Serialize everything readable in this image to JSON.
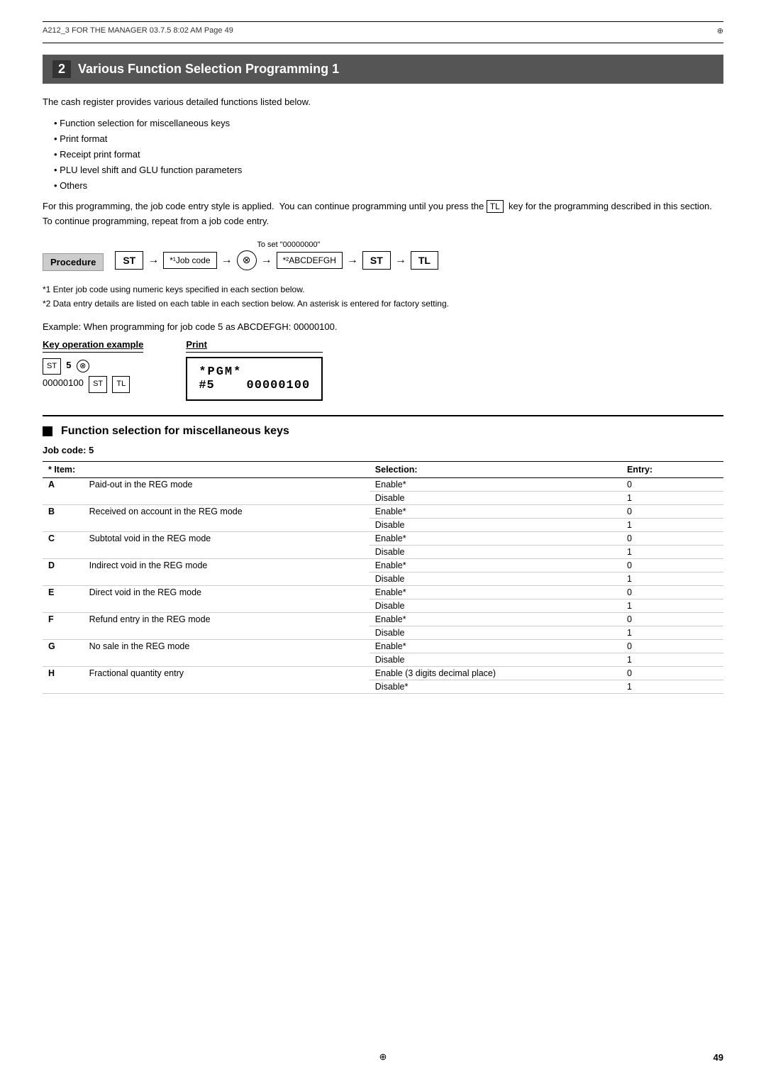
{
  "meta": {
    "header": "A212_3  FOR THE MANAGER   03.7.5  8:02 AM   Page  49"
  },
  "section": {
    "num": "2",
    "title": "Various Function Selection Programming 1"
  },
  "intro": {
    "para": "The cash register provides various detailed functions listed below.",
    "bullets": [
      "Function selection for miscellaneous keys",
      "Print format",
      "Receipt print format",
      "PLU level shift and GLU function parameters",
      "Others"
    ],
    "note": "For this programming, the job code entry style is applied.  You can continue programming until you press the  TL  key for the programming described in this section.  To continue programming, repeat from a job code entry."
  },
  "procedure": {
    "label": "Procedure",
    "toset": "To set \"00000000\"",
    "flow": [
      {
        "type": "box",
        "text": "ST"
      },
      {
        "type": "arrow",
        "text": "→"
      },
      {
        "type": "box-light",
        "text": "*¹Job code"
      },
      {
        "type": "arrow",
        "text": "→"
      },
      {
        "type": "circle",
        "text": "⊗"
      },
      {
        "type": "arrow",
        "text": "→"
      },
      {
        "type": "box-light",
        "text": "*²ABCDEFGH"
      },
      {
        "type": "arrow",
        "text": "→"
      },
      {
        "type": "box",
        "text": "ST"
      },
      {
        "type": "arrow",
        "text": "→"
      },
      {
        "type": "box",
        "text": "TL"
      }
    ]
  },
  "footnotes": [
    "*1  Enter job code using numeric keys specified in each section below.",
    "*2  Data entry details are listed on each table in each section below.  An asterisk is entered for factory setting."
  ],
  "example": {
    "text": "Example:  When programming for job code 5 as ABCDEFGH: 00000100.",
    "key_op_header": "Key operation example",
    "print_header": "Print",
    "key_ops_line1": "ST 5 ⊗",
    "key_ops_line2": "00000100 ST TL",
    "print_line1": "*PGM*",
    "print_line2": "#5    00000100"
  },
  "func_section": {
    "title": "Function selection for miscellaneous keys",
    "job_code": "Job code:  5",
    "table_headers": {
      "item": "* Item:",
      "selection": "Selection:",
      "entry": "Entry:"
    },
    "rows": [
      {
        "item": "A",
        "desc": "Paid-out in the REG mode",
        "selections": [
          {
            "sel": "Enable*",
            "entry": "0"
          },
          {
            "sel": "Disable",
            "entry": "1"
          }
        ]
      },
      {
        "item": "B",
        "desc": "Received on account in the REG mode",
        "selections": [
          {
            "sel": "Enable*",
            "entry": "0"
          },
          {
            "sel": "Disable",
            "entry": "1"
          }
        ]
      },
      {
        "item": "C",
        "desc": "Subtotal void in the REG mode",
        "selections": [
          {
            "sel": "Enable*",
            "entry": "0"
          },
          {
            "sel": "Disable",
            "entry": "1"
          }
        ]
      },
      {
        "item": "D",
        "desc": "Indirect void in the REG mode",
        "selections": [
          {
            "sel": "Enable*",
            "entry": "0"
          },
          {
            "sel": "Disable",
            "entry": "1"
          }
        ]
      },
      {
        "item": "E",
        "desc": "Direct void in the REG mode",
        "selections": [
          {
            "sel": "Enable*",
            "entry": "0"
          },
          {
            "sel": "Disable",
            "entry": "1"
          }
        ]
      },
      {
        "item": "F",
        "desc": "Refund entry in the REG mode",
        "selections": [
          {
            "sel": "Enable*",
            "entry": "0"
          },
          {
            "sel": "Disable",
            "entry": "1"
          }
        ]
      },
      {
        "item": "G",
        "desc": "No sale in the REG mode",
        "selections": [
          {
            "sel": "Enable*",
            "entry": "0"
          },
          {
            "sel": "Disable",
            "entry": "1"
          }
        ]
      },
      {
        "item": "H",
        "desc": "Fractional quantity entry",
        "selections": [
          {
            "sel": "Enable (3 digits decimal place)",
            "entry": "0"
          },
          {
            "sel": "Disable*",
            "entry": "1"
          }
        ]
      }
    ]
  },
  "page_number": "49"
}
